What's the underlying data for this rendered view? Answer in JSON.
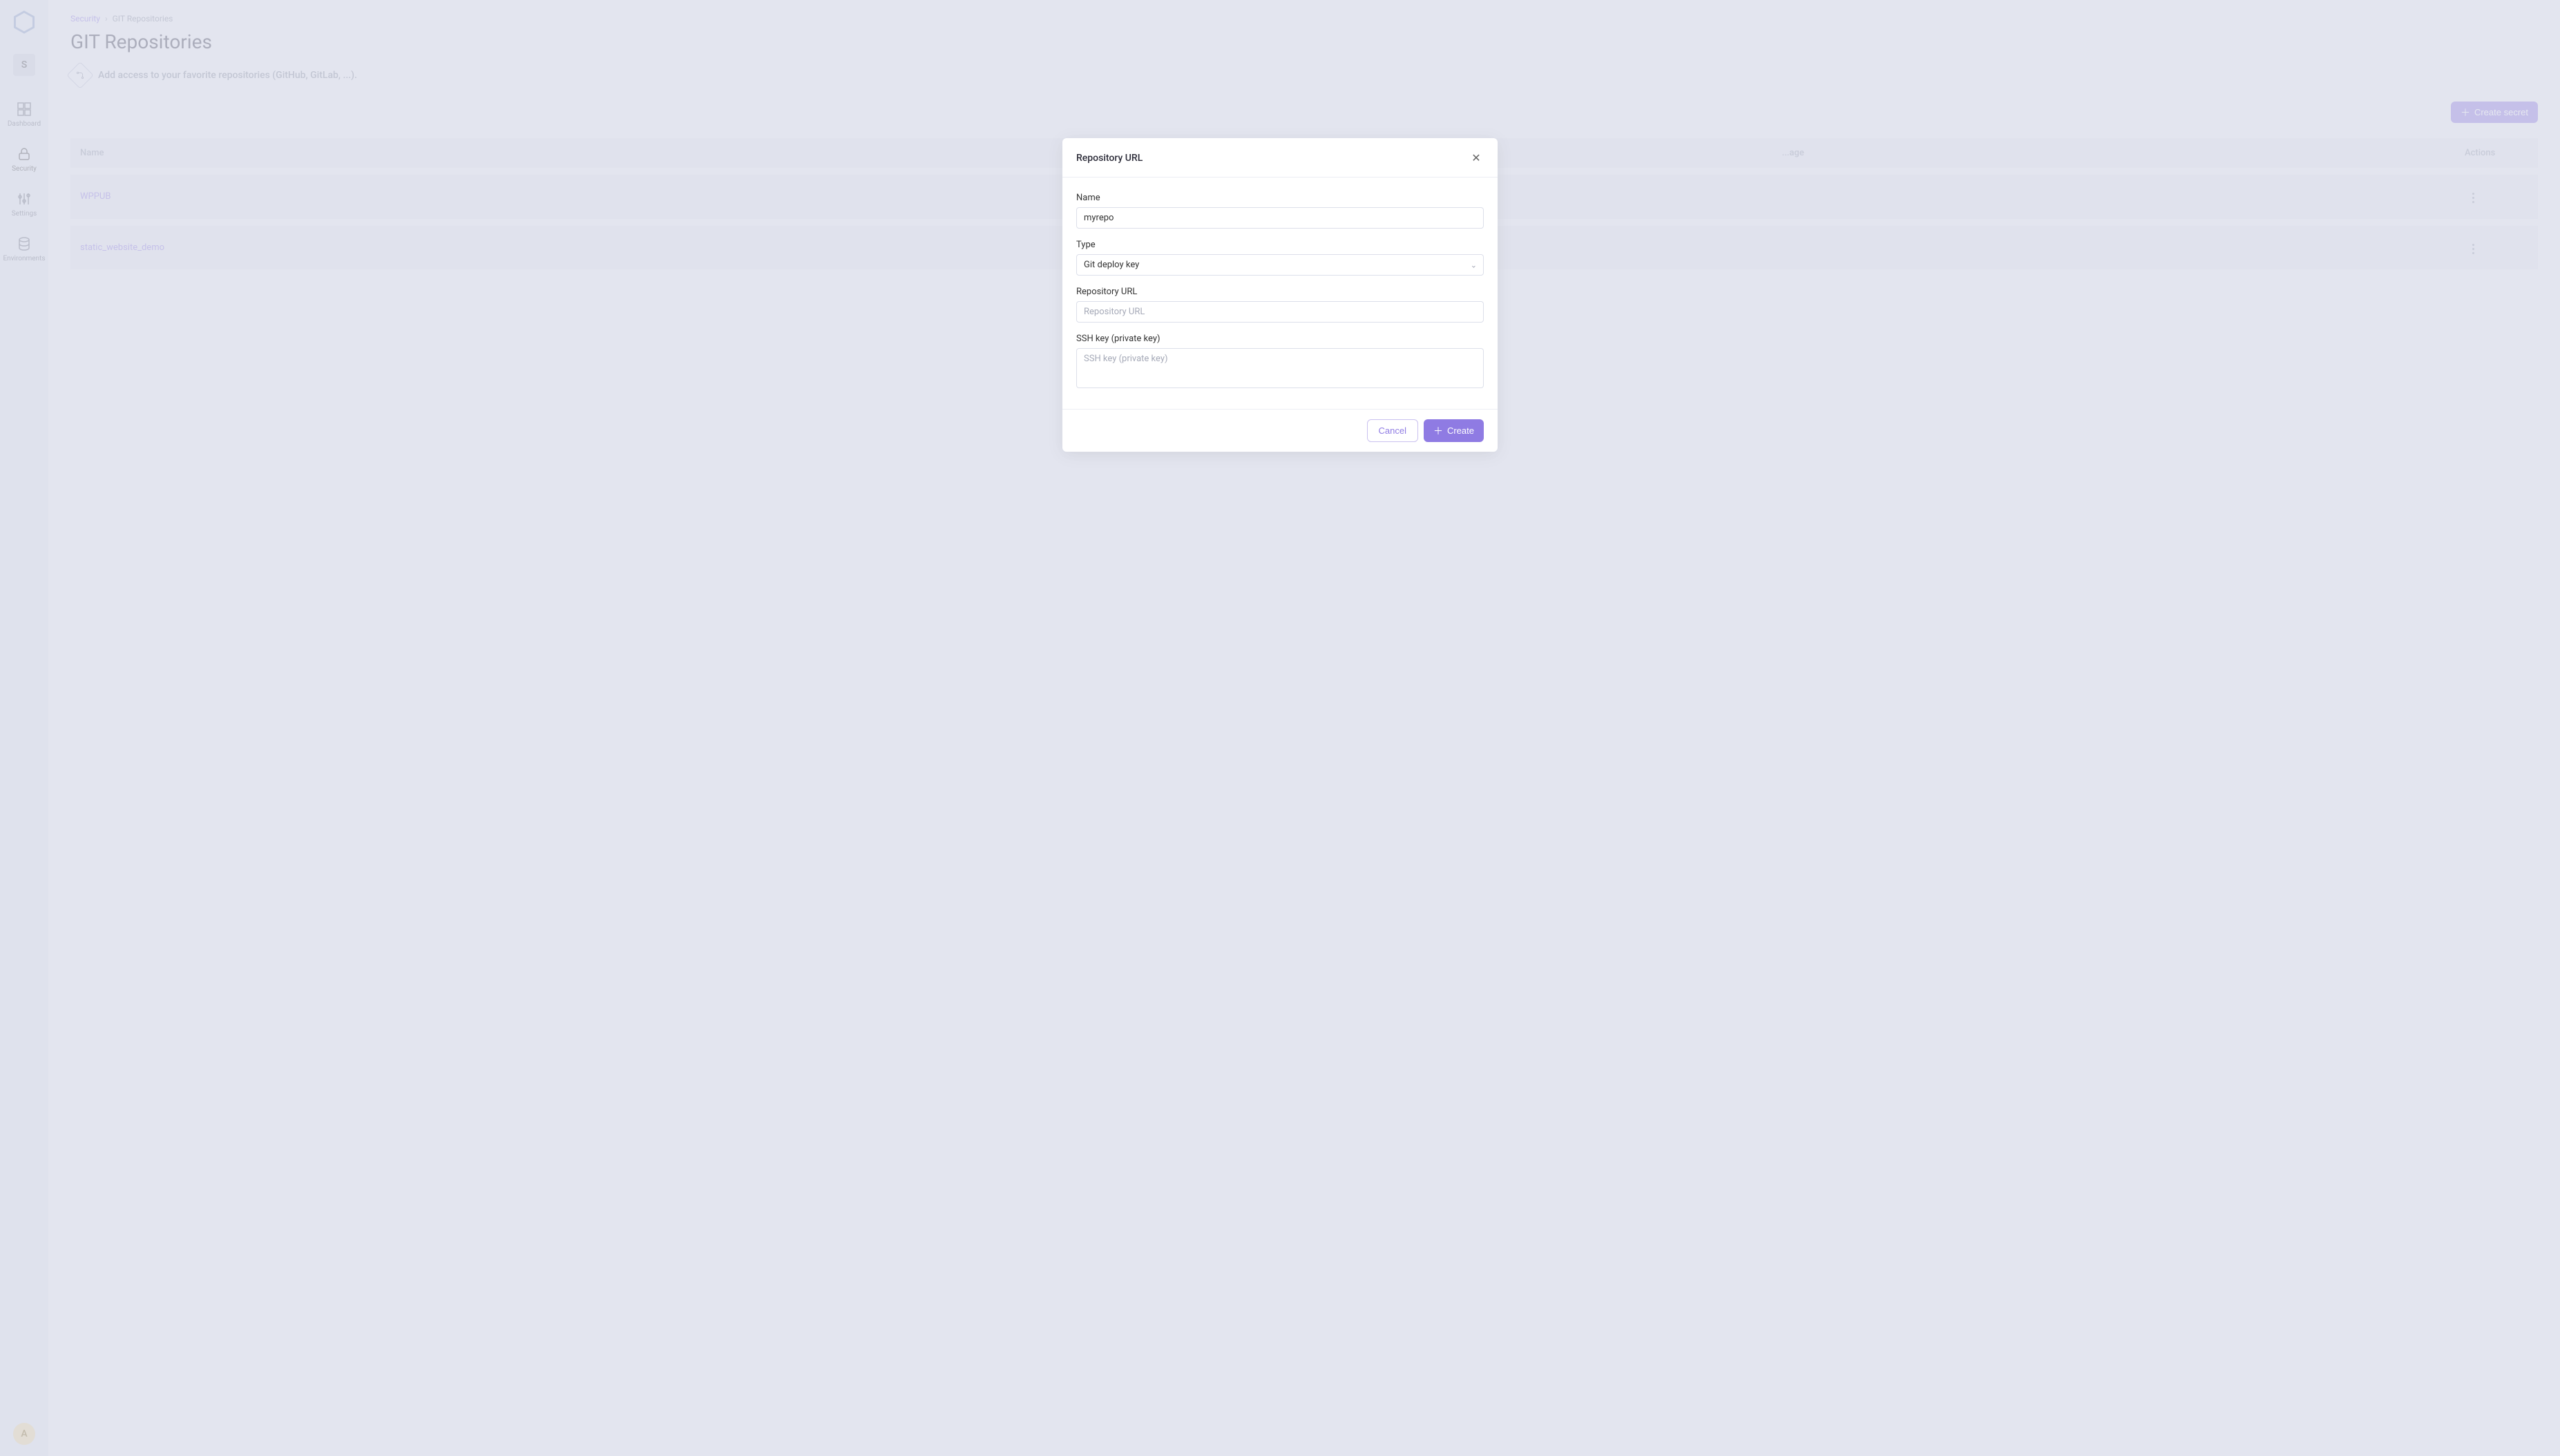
{
  "sidebar": {
    "workspace_initial": "S",
    "items": [
      {
        "label": "Dashboard"
      },
      {
        "label": "Security"
      },
      {
        "label": "Settings"
      },
      {
        "label": "Environments"
      }
    ],
    "avatar_initial": "A"
  },
  "breadcrumb": {
    "root": "Security",
    "current": "GIT Repositories"
  },
  "page": {
    "title": "GIT Repositories",
    "subtitle": "Add access to your favorite repositories (GitHub, GitLab, ...).",
    "create_button": "Create secret"
  },
  "table": {
    "headers": {
      "name": "Name",
      "usage": "...age",
      "actions": "Actions"
    },
    "rows": [
      {
        "name": "WPPUB"
      },
      {
        "name": "static_website_demo"
      }
    ]
  },
  "modal": {
    "title": "Repository URL",
    "fields": {
      "name_label": "Name",
      "name_value": "myrepo",
      "type_label": "Type",
      "type_value": "Git deploy key",
      "url_label": "Repository URL",
      "url_placeholder": "Repository URL",
      "ssh_label": "SSH key (private key)",
      "ssh_placeholder": "SSH key (private key)"
    },
    "cancel": "Cancel",
    "create": "Create"
  }
}
